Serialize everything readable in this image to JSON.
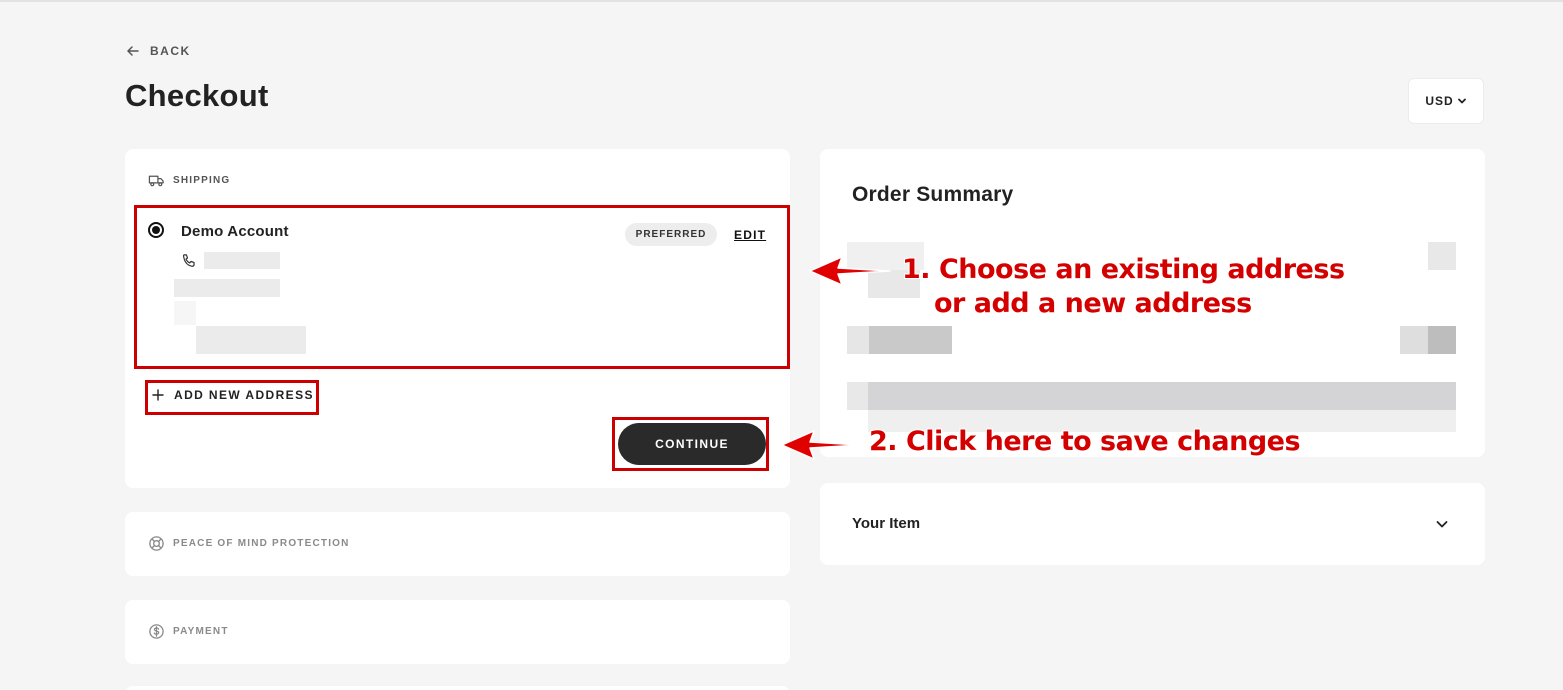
{
  "page": {
    "back_label": "BACK",
    "title": "Checkout",
    "currency": "USD"
  },
  "shipping": {
    "section_label": "SHIPPING",
    "address": {
      "name": "Demo Account",
      "badge": "PREFERRED",
      "edit_label": "EDIT"
    },
    "add_address_label": "ADD NEW ADDRESS",
    "continue_label": "CONTINUE"
  },
  "sections": {
    "peace_label": "PEACE OF MIND PROTECTION",
    "payment_label": "PAYMENT"
  },
  "summary": {
    "title": "Order Summary",
    "item_title": "Your Item"
  },
  "annotations": {
    "step1_line1": "1. Choose an existing address",
    "step1_line2": "or add a new address",
    "step2": "2. Click here to save changes",
    "color": "#d40000"
  },
  "icons": {
    "back": "arrow-left-icon",
    "shipping": "truck-icon",
    "phone": "phone-icon",
    "add": "plus-icon",
    "peace": "lifebuoy-icon",
    "payment": "dollar-circle-icon",
    "expand": "chevron-down-icon"
  }
}
